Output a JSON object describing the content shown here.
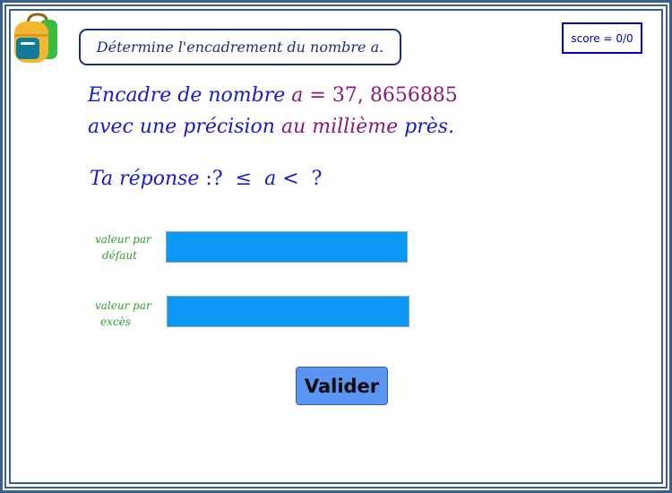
{
  "instruction": "Détermine l'encadrement du nombre a.",
  "score": {
    "label": "score",
    "equals": "=",
    "value": "0/0"
  },
  "question": {
    "line1_prefix": "Encadre de nombre",
    "variable": "a",
    "equals": "=",
    "number": "37, 8656885",
    "line2_prefix": "avec une précision",
    "precision": "au millième",
    "line2_suffix": "près."
  },
  "answer": {
    "label": "Ta réponse",
    "colon": ":",
    "lower_placeholder": "?",
    "le_symbol": "≤",
    "variable": "a",
    "lt_symbol": "<",
    "upper_placeholder": "?"
  },
  "fields": {
    "default_label_line1": "valeur par",
    "default_label_line2": "défaut",
    "default_value": "",
    "excess_label_line1": "valeur par",
    "excess_label_line2": "excès",
    "excess_value": ""
  },
  "validate_label": "Valider",
  "icons": {
    "logo": "backpack-icon"
  },
  "colors": {
    "border": "#3a5f8f",
    "instruction": "#1a2e7a",
    "question_blue": "#1a1acc",
    "highlight_magenta": "#8b1a7a",
    "label_green": "#2aa02a",
    "field_fill": "#0a98f2",
    "button_fill": "#5b95f2"
  }
}
